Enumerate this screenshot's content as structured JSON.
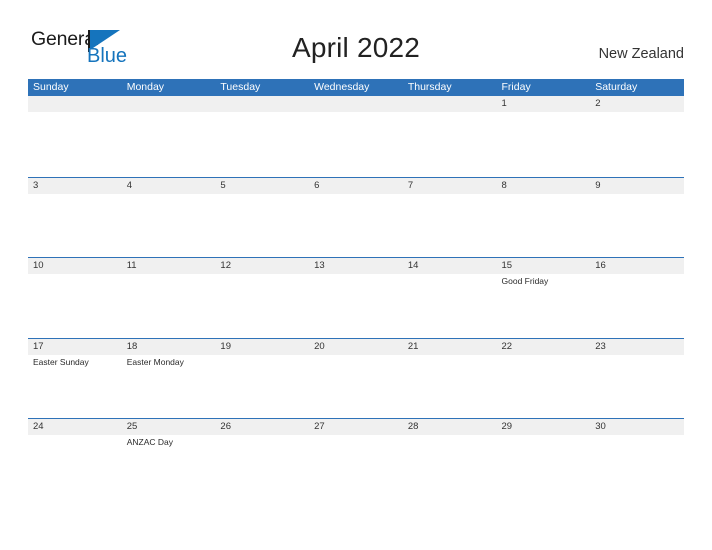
{
  "brand": {
    "name_top": "General",
    "name_bottom": "Blue",
    "flag_icon": "triangle-flag-icon",
    "accent_color": "#1574bd"
  },
  "header": {
    "title": "April 2022",
    "country": "New Zealand"
  },
  "theme": {
    "header_blue": "#2e72b8",
    "band_gray": "#f0f0f0",
    "text_dark": "#333333"
  },
  "calendar": {
    "month": "April",
    "year": "2022",
    "day_names": [
      "Sunday",
      "Monday",
      "Tuesday",
      "Wednesday",
      "Thursday",
      "Friday",
      "Saturday"
    ],
    "weeks": [
      [
        {
          "date": "",
          "event": ""
        },
        {
          "date": "",
          "event": ""
        },
        {
          "date": "",
          "event": ""
        },
        {
          "date": "",
          "event": ""
        },
        {
          "date": "",
          "event": ""
        },
        {
          "date": "1",
          "event": ""
        },
        {
          "date": "2",
          "event": ""
        }
      ],
      [
        {
          "date": "3",
          "event": ""
        },
        {
          "date": "4",
          "event": ""
        },
        {
          "date": "5",
          "event": ""
        },
        {
          "date": "6",
          "event": ""
        },
        {
          "date": "7",
          "event": ""
        },
        {
          "date": "8",
          "event": ""
        },
        {
          "date": "9",
          "event": ""
        }
      ],
      [
        {
          "date": "10",
          "event": ""
        },
        {
          "date": "11",
          "event": ""
        },
        {
          "date": "12",
          "event": ""
        },
        {
          "date": "13",
          "event": ""
        },
        {
          "date": "14",
          "event": ""
        },
        {
          "date": "15",
          "event": "Good Friday"
        },
        {
          "date": "16",
          "event": ""
        }
      ],
      [
        {
          "date": "17",
          "event": "Easter Sunday"
        },
        {
          "date": "18",
          "event": "Easter Monday"
        },
        {
          "date": "19",
          "event": ""
        },
        {
          "date": "20",
          "event": ""
        },
        {
          "date": "21",
          "event": ""
        },
        {
          "date": "22",
          "event": ""
        },
        {
          "date": "23",
          "event": ""
        }
      ],
      [
        {
          "date": "24",
          "event": ""
        },
        {
          "date": "25",
          "event": "ANZAC Day"
        },
        {
          "date": "26",
          "event": ""
        },
        {
          "date": "27",
          "event": ""
        },
        {
          "date": "28",
          "event": ""
        },
        {
          "date": "29",
          "event": ""
        },
        {
          "date": "30",
          "event": ""
        }
      ]
    ]
  }
}
